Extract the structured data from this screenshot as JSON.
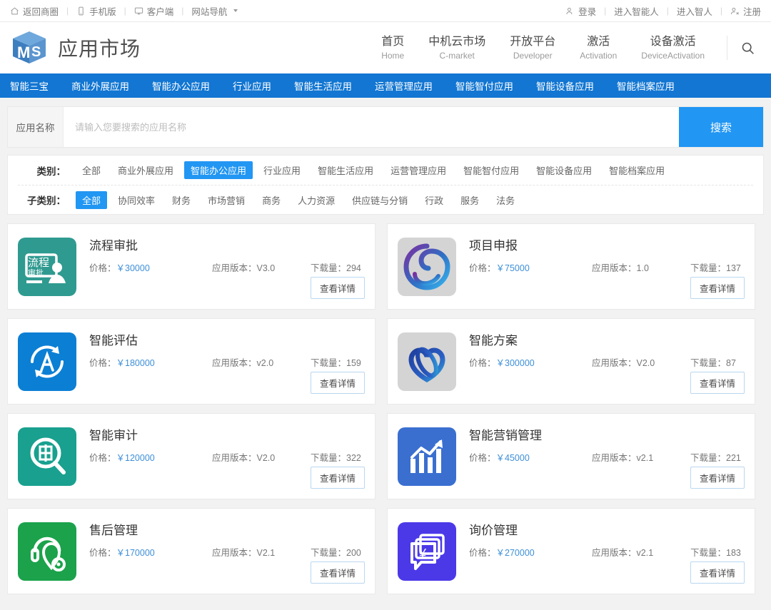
{
  "topbar": {
    "left": [
      {
        "icon": "home-icon",
        "label": "返回商圈"
      },
      {
        "icon": "mobile-icon",
        "label": "手机版"
      },
      {
        "icon": "desktop-icon",
        "label": "客户端"
      },
      {
        "icon": "none",
        "label": "网站导航",
        "caret": true
      }
    ],
    "right": [
      {
        "icon": "user-icon",
        "label": "登录"
      },
      {
        "icon": "none",
        "label": "进入智能人"
      },
      {
        "icon": "none",
        "label": "进入智人"
      },
      {
        "icon": "user-add-icon",
        "label": "注册"
      }
    ],
    "separator": "|"
  },
  "header": {
    "logo_icon": "ms-cube-logo-icon",
    "title": "应用市场",
    "nav": [
      {
        "cn": "首页",
        "en": "Home"
      },
      {
        "cn": "中机云市场",
        "en": "C-market"
      },
      {
        "cn": "开放平台",
        "en": "Developer"
      },
      {
        "cn": "激活",
        "en": "Activation"
      },
      {
        "cn": "设备激活",
        "en": "DeviceActivation"
      }
    ],
    "search_icon": "search-icon"
  },
  "catbar": {
    "accent": "#1276d2",
    "items": [
      "智能三宝",
      "商业外展应用",
      "智能办公应用",
      "行业应用",
      "智能生活应用",
      "运营管理应用",
      "智能智付应用",
      "智能设备应用",
      "智能档案应用"
    ]
  },
  "search": {
    "label": "应用名称",
    "placeholder": "请输入您要搜索的应用名称",
    "value": "",
    "button": "搜索",
    "button_color": "#2196f3"
  },
  "filters": [
    {
      "label": "类别：",
      "selected": "智能办公应用",
      "options": [
        "全部",
        "商业外展应用",
        "智能办公应用",
        "行业应用",
        "智能生活应用",
        "运营管理应用",
        "智能智付应用",
        "智能设备应用",
        "智能档案应用"
      ]
    },
    {
      "label": "子类别：",
      "selected": "全部",
      "options": [
        "全部",
        "协同效率",
        "财务",
        "市场营销",
        "商务",
        "人力资源",
        "供应链与分销",
        "行政",
        "服务",
        "法务"
      ]
    }
  ],
  "card_labels": {
    "price": "价格：",
    "currency": "￥",
    "version": "应用版本：",
    "downloads": "下载量：",
    "detail_button": "查看详情"
  },
  "apps": [
    {
      "name": "流程审批",
      "price": "30000",
      "version": "V3.0",
      "downloads": "294",
      "icon": "process-approval-icon",
      "icon_bg": "#2f9a90"
    },
    {
      "name": "项目申报",
      "price": "75000",
      "version": "1.0",
      "downloads": "137",
      "icon": "project-declaration-swirl-icon",
      "icon_bg": "#d4d4d4"
    },
    {
      "name": "智能评估",
      "price": "180000",
      "version": "v2.0",
      "downloads": "159",
      "icon": "smart-assessment-icon",
      "icon_bg": "#0b7fd4"
    },
    {
      "name": "智能方案",
      "price": "300000",
      "version": "V2.0",
      "downloads": "87",
      "icon": "smart-solution-ribbon-icon",
      "icon_bg": "#d4d4d4"
    },
    {
      "name": "智能审计",
      "price": "120000",
      "version": "V2.0",
      "downloads": "322",
      "icon": "smart-audit-magnifier-icon",
      "icon_bg": "#19a08f"
    },
    {
      "name": "智能营销管理",
      "price": "45000",
      "version": "v2.1",
      "downloads": "221",
      "icon": "smart-marketing-chart-icon",
      "icon_bg": "#3a6fd0"
    },
    {
      "name": "售后管理",
      "price": "170000",
      "version": "V2.1",
      "downloads": "200",
      "icon": "after-sales-headset-icon",
      "icon_bg": "#1ba24b"
    },
    {
      "name": "询价管理",
      "price": "270000",
      "version": "v2.1",
      "downloads": "183",
      "icon": "inquiry-chat-yuan-icon",
      "icon_bg": "#4b39e8"
    }
  ]
}
